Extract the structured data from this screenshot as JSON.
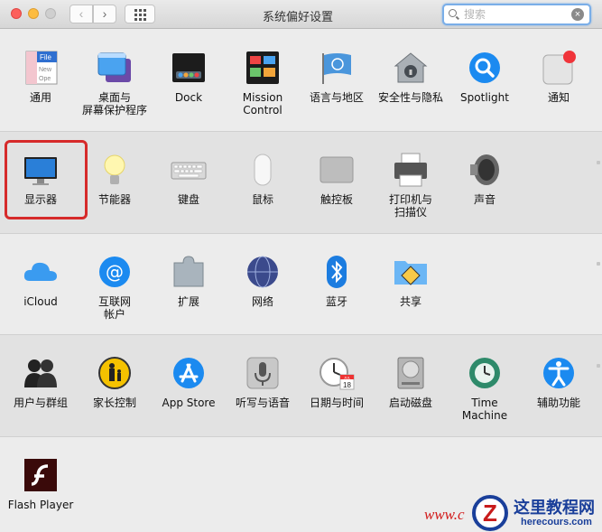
{
  "window": {
    "title": "系统偏好设置"
  },
  "toolbar": {
    "back": "‹",
    "forward": "›"
  },
  "search": {
    "placeholder": "搜索",
    "clear": "×"
  },
  "panes": {
    "general": "通用",
    "desktop": "桌面与\n屏幕保护程序",
    "dock": "Dock",
    "mission": "Mission\nControl",
    "language": "语言与地区",
    "security": "安全性与隐私",
    "spotlight": "Spotlight",
    "notifications": "通知",
    "displays": "显示器",
    "energy": "节能器",
    "keyboard": "键盘",
    "mouse": "鼠标",
    "trackpad": "触控板",
    "printers": "打印机与\n扫描仪",
    "sound": "声音",
    "icloud": "iCloud",
    "internet": "互联网\n帐户",
    "extensions": "扩展",
    "network": "网络",
    "bluetooth": "蓝牙",
    "sharing": "共享",
    "users": "用户与群组",
    "parental": "家长控制",
    "appstore": "App Store",
    "dictation": "听写与语音",
    "datetime": "日期与时间",
    "startup": "启动磁盘",
    "timemachine": "Time Machine",
    "accessibility": "辅助功能",
    "flash": "Flash Player"
  },
  "icon_text": {
    "general_file": "File",
    "general_new": "New",
    "general_ope": "Ope",
    "calendar_month": "JUL",
    "calendar_day": "18"
  },
  "watermark": {
    "www": "www.c",
    "logo": "Z",
    "name": "这里教程网",
    "url": "herecours.com"
  },
  "colors": {
    "highlight": "#d62a2a",
    "accent": "#1b8af0"
  }
}
